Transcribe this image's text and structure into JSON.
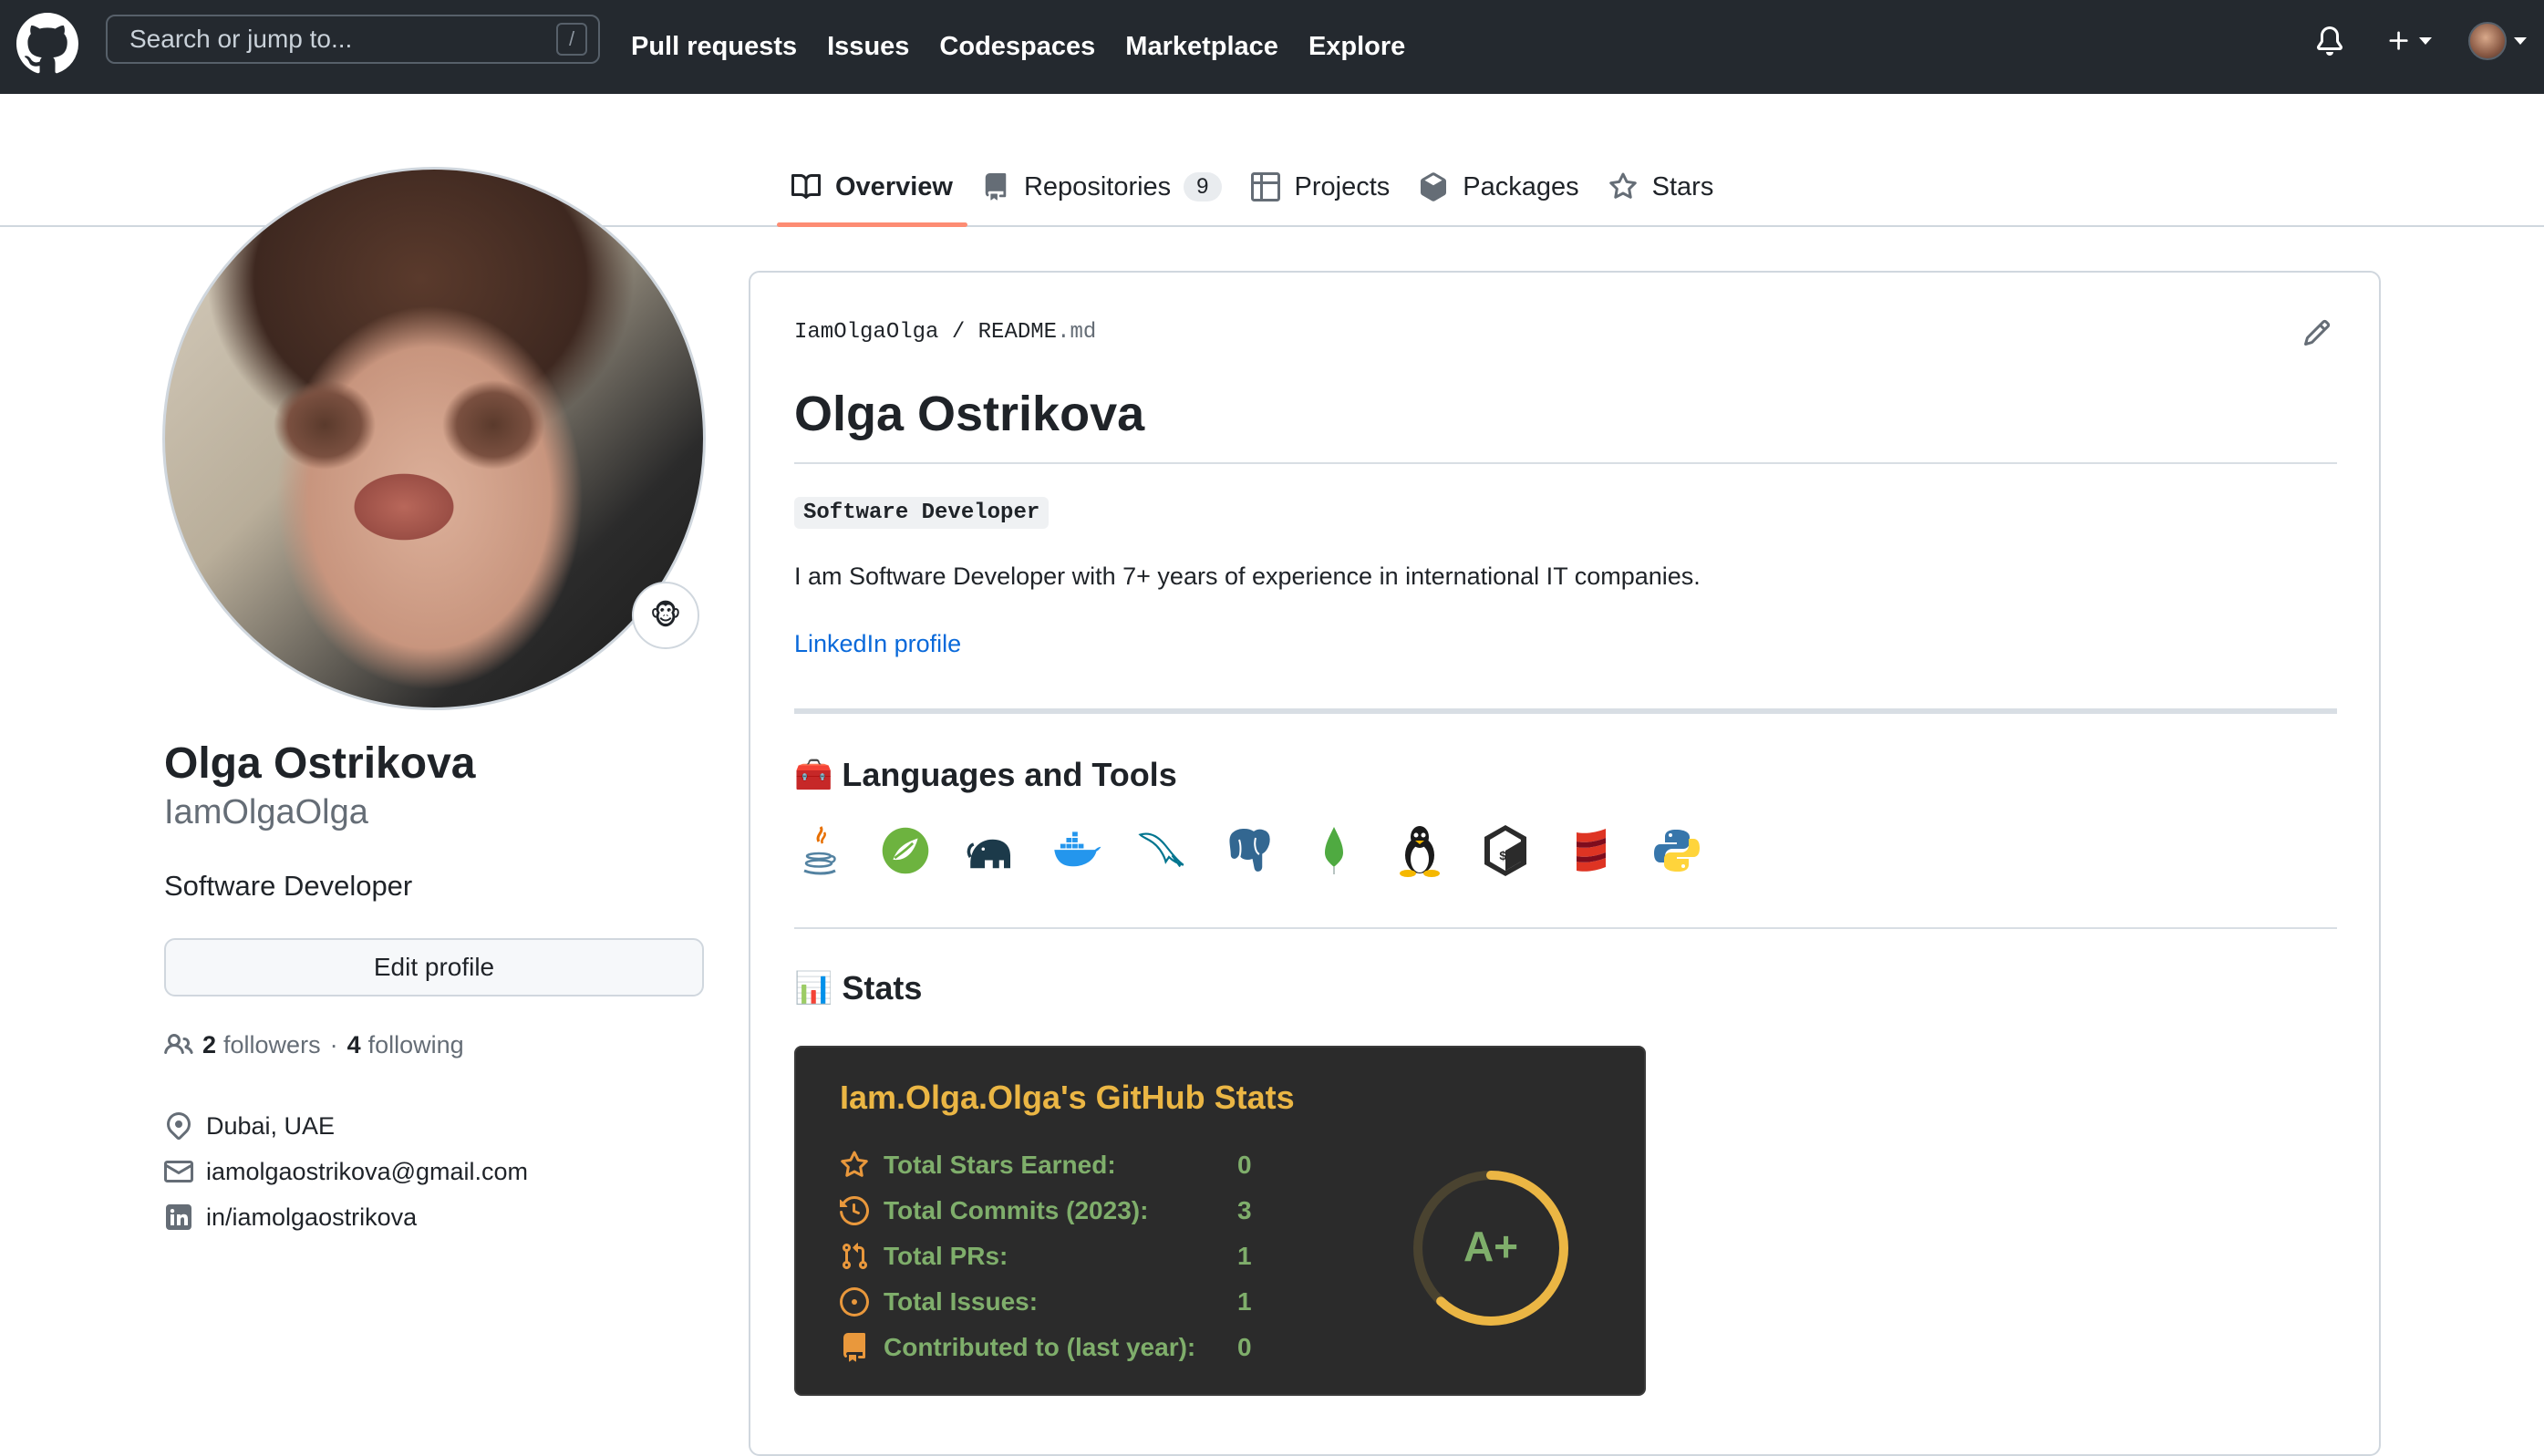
{
  "header": {
    "search_placeholder": "Search or jump to...",
    "search_key": "/",
    "nav": [
      "Pull requests",
      "Issues",
      "Codespaces",
      "Marketplace",
      "Explore"
    ]
  },
  "tabs": [
    {
      "label": "Overview",
      "active": true,
      "icon": "book-icon"
    },
    {
      "label": "Repositories",
      "counter": "9",
      "icon": "repo-icon"
    },
    {
      "label": "Projects",
      "icon": "table-icon"
    },
    {
      "label": "Packages",
      "icon": "package-icon"
    },
    {
      "label": "Stars",
      "icon": "star-icon"
    }
  ],
  "profile": {
    "name": "Olga Ostrikova",
    "login": "IamOlgaOlga",
    "bio": "Software Developer",
    "status_emoji": "🐵",
    "edit_label": "Edit profile",
    "followers_count": "2",
    "followers_label": "followers",
    "separator": "·",
    "following_count": "4",
    "following_label": "following",
    "location": "Dubai, UAE",
    "email": "iamolgaostrikova@gmail.com",
    "linkedin": "in/iamolgaostrikova"
  },
  "readme": {
    "owner": "IamOlgaOlga",
    "sep": "/",
    "file": "README",
    "ext": ".md",
    "title": "Olga Ostrikova",
    "badge": "Software Developer",
    "description": "I am Software Developer with 7+ years of experience in international IT companies.",
    "link_text": "LinkedIn profile",
    "tools_title": "Languages and Tools",
    "tools_emoji": "🧰",
    "tools": [
      "java-icon",
      "spring-icon",
      "hadoop-icon",
      "docker-icon",
      "mysql-icon",
      "postgresql-icon",
      "mongodb-icon",
      "linux-icon",
      "bash-icon",
      "scala-icon",
      "python-icon"
    ],
    "stats_title": "Stats",
    "stats_emoji": "📊"
  },
  "stats_card": {
    "title": "Iam.Olga.Olga's GitHub Stats",
    "rows": [
      {
        "label": "Total Stars Earned:",
        "value": "0",
        "icon": "star-icon"
      },
      {
        "label": "Total Commits (2023):",
        "value": "3",
        "icon": "history-icon"
      },
      {
        "label": "Total PRs:",
        "value": "1",
        "icon": "pull-request-icon"
      },
      {
        "label": "Total Issues:",
        "value": "1",
        "icon": "issue-icon"
      },
      {
        "label": "Contributed to (last year):",
        "value": "0",
        "icon": "repo-icon"
      }
    ],
    "rank": "A+",
    "rank_progress": 0.62,
    "colors": {
      "title": "#ebb644",
      "text": "#7fae6b",
      "icon": "#e9983c",
      "bg": "#2b2b2b"
    }
  }
}
